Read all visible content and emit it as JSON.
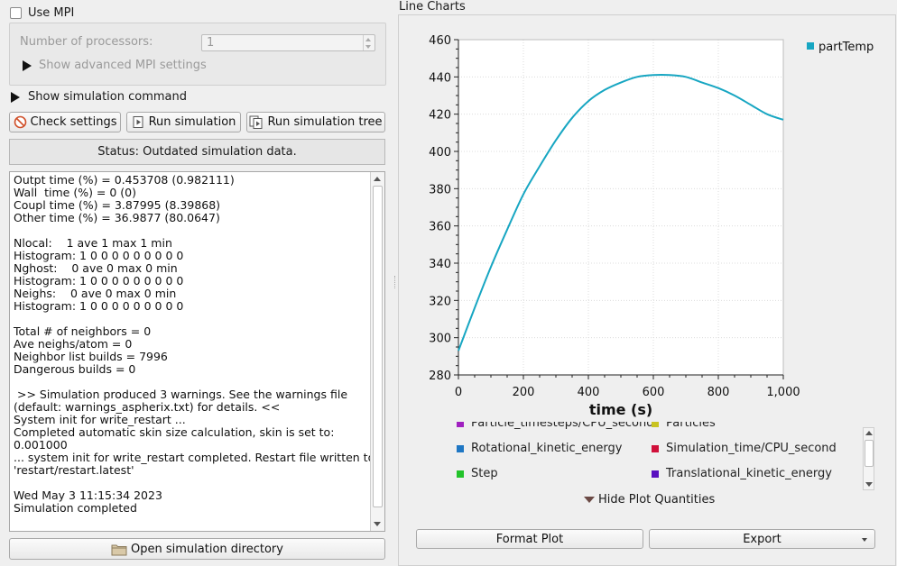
{
  "mpi": {
    "use_mpi_label": "Use MPI",
    "use_mpi_checked": false,
    "num_processors_label": "Number of processors:",
    "num_processors_value": "1",
    "advanced_label": "Show advanced MPI settings"
  },
  "sim_command": {
    "label": "Show simulation command"
  },
  "buttons": {
    "check_settings": "Check settings",
    "run_simulation": "Run simulation",
    "run_simulation_tree": "Run simulation tree",
    "open_directory": "Open simulation directory"
  },
  "status": {
    "text": "Status: Outdated simulation data."
  },
  "log": {
    "lines": [
      "Outpt time (%) = 0.453708 (0.982111)",
      "Wall  time (%) = 0 (0)",
      "Coupl time (%) = 3.87995 (8.39868)",
      "Other time (%) = 36.9877 (80.0647)",
      "",
      "Nlocal:    1 ave 1 max 1 min",
      "Histogram: 1 0 0 0 0 0 0 0 0 0",
      "Nghost:    0 ave 0 max 0 min",
      "Histogram: 1 0 0 0 0 0 0 0 0 0",
      "Neighs:    0 ave 0 max 0 min",
      "Histogram: 1 0 0 0 0 0 0 0 0 0",
      "",
      "Total # of neighbors = 0",
      "Ave neighs/atom = 0",
      "Neighbor list builds = 7996",
      "Dangerous builds = 0",
      "",
      " >> Simulation produced 3 warnings. See the warnings file",
      "(default: warnings_aspherix.txt) for details. <<",
      "System init for write_restart ...",
      "Completed automatic skin size calculation, skin is set to:",
      "0.001000",
      "... system init for write_restart completed. Restart file written to",
      "'restart/restart.latest'",
      "",
      "Wed May 3 11:15:34 2023",
      "Simulation completed"
    ]
  },
  "right": {
    "title": "Line Charts",
    "hide_quantities_label": "Hide Plot Quantities",
    "format_plot": "Format Plot",
    "export": "Export",
    "quantities": [
      {
        "label": "Particle_timesteps/CPU_second",
        "color": "#a020c0"
      },
      {
        "label": "Particles",
        "color": "#c9c320"
      },
      {
        "label": "Rotational_kinetic_energy",
        "color": "#1f77c4"
      },
      {
        "label": "Simulation_time/CPU_second",
        "color": "#d0103a"
      },
      {
        "label": "Step",
        "color": "#22c32a"
      },
      {
        "label": "Translational_kinetic_energy",
        "color": "#5a10c0"
      }
    ]
  },
  "chart_data": {
    "type": "line",
    "xlabel": "time (s)",
    "ylabel": "",
    "xlim": [
      0,
      1000
    ],
    "ylim": [
      280,
      460
    ],
    "x_ticks": [
      "0",
      "200",
      "400",
      "600",
      "800",
      "1,000"
    ],
    "y_ticks": [
      "280",
      "300",
      "320",
      "340",
      "360",
      "380",
      "400",
      "420",
      "440",
      "460"
    ],
    "grid": true,
    "legend_position": "right",
    "series": [
      {
        "name": "partTemp",
        "color": "#17a6c2",
        "x": [
          0,
          50,
          100,
          150,
          200,
          250,
          300,
          350,
          400,
          450,
          500,
          550,
          600,
          650,
          700,
          750,
          800,
          850,
          900,
          950,
          1000
        ],
        "y": [
          293,
          316,
          338,
          358,
          377,
          392,
          406,
          418,
          427,
          433,
          437,
          440,
          441,
          441,
          440,
          437,
          434,
          430,
          425,
          420,
          417
        ]
      }
    ]
  }
}
